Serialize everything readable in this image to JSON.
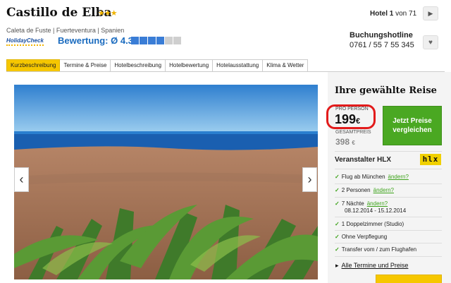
{
  "hotel": {
    "name": "Castillo de Elba",
    "stars": "★★★",
    "location": "Caleta de Fuste | Fuerteventura | Spanien",
    "holidaycheck_logo": "HolidayCheck",
    "rating_label": "Bewertung: Ø 4.3",
    "rating_value": 4.3
  },
  "pager": {
    "label": "Hotel",
    "current": "1",
    "text": " von 71"
  },
  "hotline": {
    "label": "Buchungshotline",
    "number": "0761 / 55 7 55 345"
  },
  "tabs": [
    {
      "label": "Kurzbeschreibung",
      "active": true
    },
    {
      "label": "Termine & Preise"
    },
    {
      "label": "Hotelbeschreibung"
    },
    {
      "label": "Hotelbewertung"
    },
    {
      "label": "Hotelausstattung"
    },
    {
      "label": "Klima & Wetter"
    }
  ],
  "panel": {
    "title": "Ihre gewählte Reise",
    "per_person_label": "PRO PERSON",
    "per_person_price": "199",
    "total_label": "GESAMTPREIS",
    "total_price": "398",
    "currency": "€",
    "cta": "Jetzt Preise vergleichen",
    "operator_label": "Veranstalter HLX",
    "operator_logo": "hlx",
    "features": [
      {
        "text": "Flug ab München",
        "change": "ändern?"
      },
      {
        "text": "2 Personen",
        "change": "ändern?"
      },
      {
        "text": "7 Nächte",
        "change": "ändern?"
      },
      {
        "text": "1 Doppelzimmer (Studio)"
      },
      {
        "text": "Ohne Verpflegung"
      },
      {
        "text": "Transfer vom / zum Flughafen"
      }
    ],
    "dates": "08.12.2014 - 15.12.2014",
    "all_dates_link": "Alle Termine und Preise"
  },
  "colors": {
    "accent_yellow": "#f6c700",
    "accent_green": "#4aa822",
    "highlight_red": "#e21b1b",
    "link_blue": "#1a6bbf"
  },
  "icons": {
    "next": "chevron-right-icon",
    "favorite": "heart-icon",
    "gallery_prev": "chevron-left-icon",
    "gallery_next": "chevron-right-icon",
    "check": "checkmark-icon"
  }
}
